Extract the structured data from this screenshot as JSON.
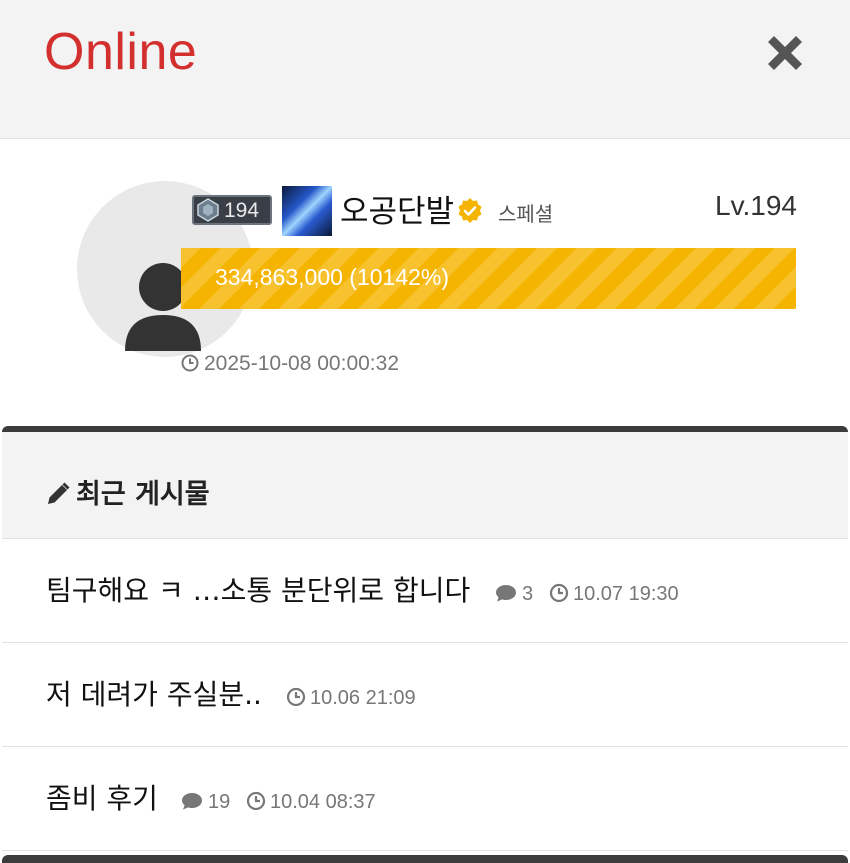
{
  "header": {
    "title": "Online"
  },
  "profile": {
    "rank_number": "194",
    "nickname": "오공단발",
    "role": "스페셜",
    "level": "Lv.194",
    "xp_text": "334,863,000 (10142%)",
    "xp_progress_percent": 100,
    "last_seen": "2025-10-08 00:00:32",
    "accent_color": "#f5b400"
  },
  "posts": {
    "section_title": "최근 게시물",
    "items": [
      {
        "title": "팀구해요 ㅋ …소통 분단위로 합니다",
        "comments": "3",
        "time": "10.07 19:30"
      },
      {
        "title": "저 데려가 주실분..",
        "comments": "",
        "time": "10.06 21:09"
      },
      {
        "title": "좀비 후기",
        "comments": "19",
        "time": "10.04 08:37"
      }
    ]
  },
  "colors": {
    "brand": "#d32f2f",
    "xp": "#f5b400",
    "text_muted": "#777777"
  }
}
